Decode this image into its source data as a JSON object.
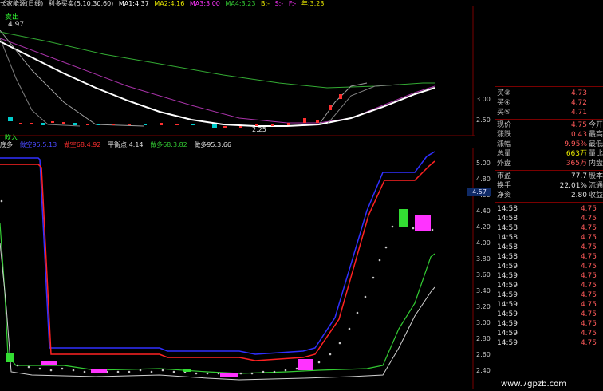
{
  "topbar": {
    "title": "长家能源(日线)",
    "ma_header": "利多买卖(5,10,30,60)",
    "ma1": "MA1:4.37",
    "ma2": "MA2:4.16",
    "ma3": "MA3:3.00",
    "ma4": "MA4:3.23",
    "b": "B:-",
    "s": "S:-",
    "f": "F:-",
    "year": "年:3.23"
  },
  "upper": {
    "sell_label": "卖出",
    "high_label": "4.97",
    "low_label": "2.25",
    "axis": [
      "3.00",
      "2.50"
    ]
  },
  "indicator": {
    "title": "底多",
    "short": "做空95:5.13",
    "short2": "做空68:4.92",
    "balance": "平衡点:4.14",
    "long": "做多68:3.82",
    "long2": "做多95:3.66",
    "axis": [
      "5.00",
      "4.80",
      "4.60",
      "4.40",
      "4.20",
      "4.00",
      "3.80",
      "3.60",
      "3.40",
      "3.20",
      "3.00",
      "2.80",
      "2.60",
      "2.40"
    ],
    "price_tag": "4.57",
    "buy_tag": "吹入"
  },
  "orderbook": [
    {
      "label": "买③",
      "value": "4.73"
    },
    {
      "label": "买④",
      "value": "4.72"
    },
    {
      "label": "买⑤",
      "value": "4.71"
    }
  ],
  "quote": [
    {
      "label": "现价",
      "value": "4.75",
      "label2": "今开"
    },
    {
      "label": "涨跌",
      "value": "0.43",
      "label2": "最高"
    },
    {
      "label": "涨幅",
      "value": "9.95%",
      "label2": "最低"
    },
    {
      "label": "总量",
      "value": "663万",
      "label2": "量比"
    },
    {
      "label": "外盘",
      "value": "365万",
      "label2": "内盘"
    }
  ],
  "fundamentals": [
    {
      "label": "市盈",
      "value": "77.7",
      "label2": "股本"
    },
    {
      "label": "换手",
      "value": "22.01%",
      "label2": "流通"
    },
    {
      "label": "净资",
      "value": "2.80",
      "label2": "收益"
    }
  ],
  "ticks": [
    {
      "time": "14:58",
      "price": "4.75"
    },
    {
      "time": "14:58",
      "price": "4.75"
    },
    {
      "time": "14:58",
      "price": "4.75"
    },
    {
      "time": "14:58",
      "price": "4.75"
    },
    {
      "time": "14:58",
      "price": "4.75"
    },
    {
      "time": "14:58",
      "price": "4.75"
    },
    {
      "time": "14:59",
      "price": "4.75"
    },
    {
      "time": "14:59",
      "price": "4.75"
    },
    {
      "time": "14:59",
      "price": "4.75"
    },
    {
      "time": "14:59",
      "price": "4.75"
    },
    {
      "time": "14:59",
      "price": "4.75"
    },
    {
      "time": "14:59",
      "price": "4.75"
    },
    {
      "time": "14:59",
      "price": "4.75"
    },
    {
      "time": "14:59",
      "price": "4.75"
    },
    {
      "time": "14:59",
      "price": "4.75"
    }
  ],
  "watermark": "www.7gpzb.com",
  "colors": {
    "up": "#ff3030",
    "down": "#00e0e0",
    "ma_white": "#ffffff",
    "ma_green": "#33cc33",
    "ma_magenta": "#cc33cc",
    "ma_gray": "#b0b0b0",
    "short_line": "#2a2aff",
    "long_line": "#33cc33",
    "balance_dots": "#c0c0c0",
    "accent_magenta": "#ff33ff",
    "accent_green": "#33ff33",
    "grid": "#7a0000"
  }
}
